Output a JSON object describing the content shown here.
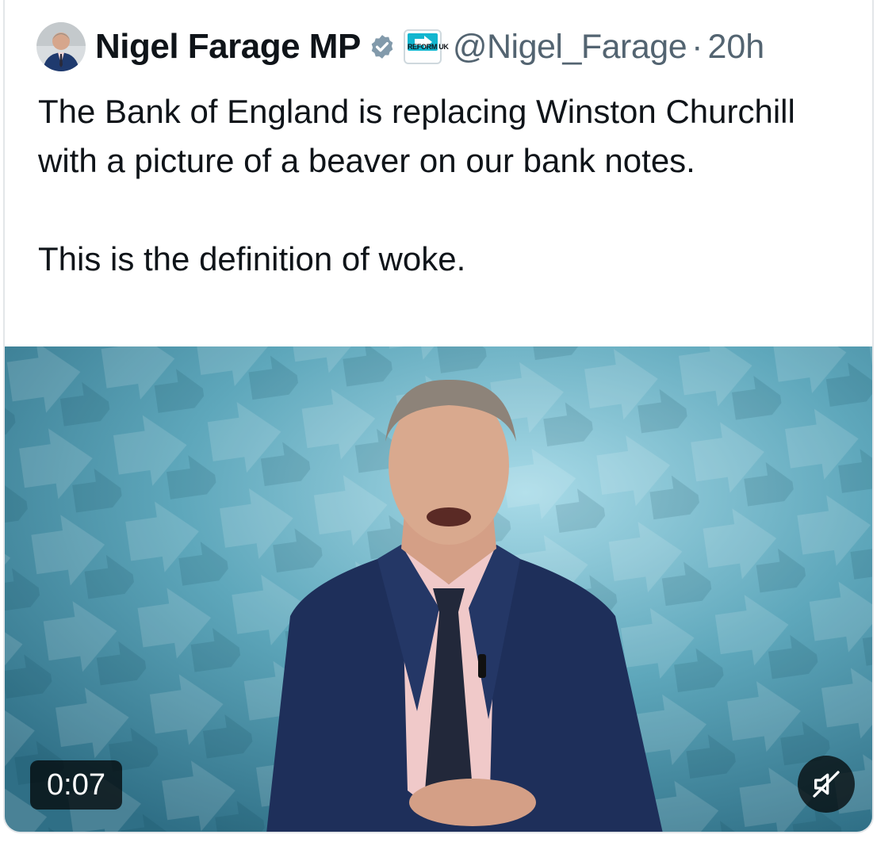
{
  "tweet": {
    "author": {
      "display_name": "Nigel Farage MP",
      "handle": "@Nigel_Farage",
      "verified_icon": "verified-badge-icon",
      "affiliate_badge": {
        "label": "REFORM UK",
        "icon": "reform-uk-badge-icon"
      }
    },
    "separator": "·",
    "timestamp": "20h",
    "text_paragraphs": [
      "The Bank of England is replacing Winston Churchill with a picture of a beaver on our bank notes.",
      "This is the definition of woke."
    ],
    "media": {
      "type": "video",
      "duration": "0:07",
      "mute_icon": "muted-speaker-icon"
    }
  },
  "colors": {
    "text_primary": "#0f1419",
    "text_secondary": "#536471",
    "verified_badge": "#829aab",
    "affiliate_accent": "#12b6cf",
    "media_background": "#5aa3b6",
    "overlay": "rgba(0,0,0,0.72)"
  }
}
